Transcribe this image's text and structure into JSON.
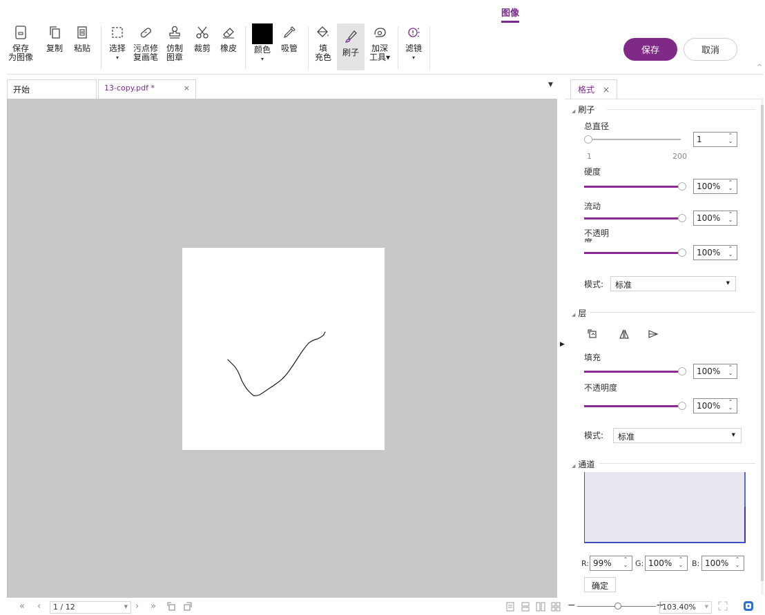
{
  "ribbon": {
    "active_tab": "图像"
  },
  "toolbar": {
    "tools": [
      {
        "id": "save-as-image",
        "l1": "保存",
        "l2": "为图像",
        "icon": "save-image-icon"
      },
      {
        "id": "copy",
        "l1": "复制",
        "l2": "",
        "icon": "copy-icon"
      },
      {
        "id": "paste",
        "l1": "粘贴",
        "l2": "",
        "icon": "paste-icon"
      },
      {
        "id": "select",
        "l1": "选择",
        "l2": "▾",
        "icon": "select-rect-icon"
      },
      {
        "id": "spot-heal",
        "l1": "污点修",
        "l2": "复画笔",
        "icon": "bandage-icon"
      },
      {
        "id": "clone-stamp",
        "l1": "仿制",
        "l2": "图章",
        "icon": "stamp-icon"
      },
      {
        "id": "crop",
        "l1": "裁剪",
        "l2": "",
        "icon": "scissors-icon"
      },
      {
        "id": "eraser",
        "l1": "橡皮",
        "l2": "",
        "icon": "eraser-icon"
      },
      {
        "id": "color",
        "l1": "颜色",
        "l2": "▾",
        "icon": "color-swatch-icon"
      },
      {
        "id": "eyedropper",
        "l1": "吸管",
        "l2": "",
        "icon": "eyedropper-icon"
      },
      {
        "id": "fill",
        "l1": "填",
        "l2": "充色",
        "icon": "paint-bucket-icon"
      },
      {
        "id": "brush",
        "l1": "刷子",
        "l2": "",
        "icon": "brush-icon"
      },
      {
        "id": "burn",
        "l1": "加深",
        "l2": "工具▾",
        "icon": "burn-tool-icon"
      },
      {
        "id": "filter",
        "l1": "滤镜",
        "l2": "▾",
        "icon": "filter-icon"
      }
    ],
    "swatch_color": "#000000",
    "save_label": "保存",
    "cancel_label": "取消"
  },
  "tabs": {
    "home": "开始",
    "file": "13-copy.pdf *",
    "close": "×"
  },
  "panel": {
    "tab": "格式",
    "close": "×",
    "brush": {
      "title": "刷子",
      "diameter_label": "总直径",
      "diameter_value": "1",
      "diameter_min": "1",
      "diameter_max": "200",
      "hardness_label": "硬度",
      "hardness_value": "100%",
      "flow_label": "流动",
      "flow_value": "100%",
      "opacity_label": "不透明",
      "opacity_label_2": "度",
      "opacity_value": "100%",
      "mode_label": "模式:",
      "mode_value": "标准"
    },
    "layer": {
      "title": "层",
      "fill_label": "填充",
      "fill_value": "100%",
      "opacity_label": "不透明度",
      "opacity_value": "100%",
      "mode_label": "模式:",
      "mode_value": "标准"
    },
    "channel": {
      "title": "通道",
      "r_label": "R:",
      "r_value": "99%",
      "g_label": "G:",
      "g_value": "100%",
      "b_label": "B:",
      "b_value": "100%",
      "ok_label": "确定"
    }
  },
  "status": {
    "page_value": "1 / 12",
    "zoom_value": "103.40%",
    "zoom_minus": "−",
    "zoom_plus": "+"
  },
  "accent_color": "#7e2a86"
}
